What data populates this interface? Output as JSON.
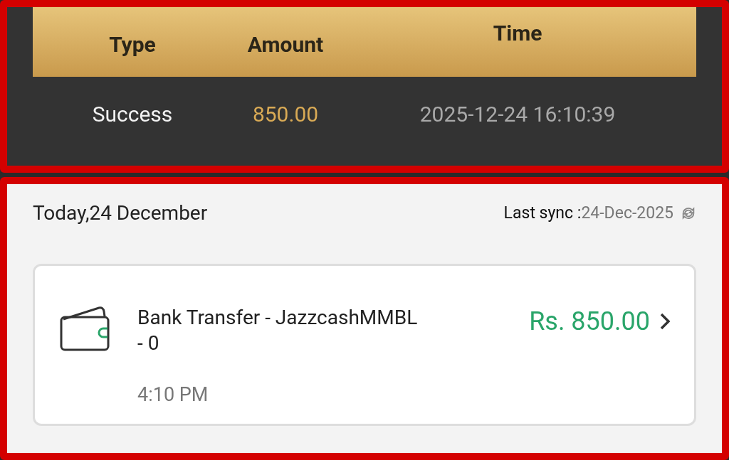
{
  "withdraw_table": {
    "columns": [
      "Type",
      "Amount",
      "Time"
    ],
    "rows": [
      {
        "type": "Success",
        "amount": "850.00",
        "time": "2025-12-24 16:10:39"
      }
    ]
  },
  "history": {
    "date_heading": "Today,24 December",
    "sync_label": "Last sync :",
    "sync_date": "24-Dec-2025",
    "transactions": [
      {
        "title": "Bank Transfer - JazzcashMMBL",
        "account": "- 0",
        "amount": "Rs. 850.00",
        "time": "4:10 PM"
      }
    ]
  }
}
